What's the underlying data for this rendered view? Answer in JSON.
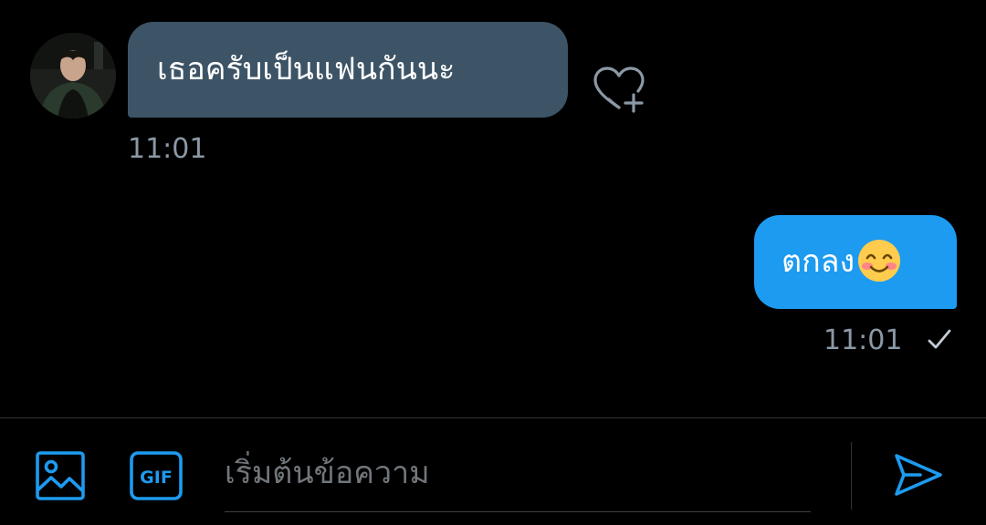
{
  "conversation": {
    "incoming": {
      "text": "เธอครับเป็นแฟนกันนะ",
      "time": "11:01",
      "avatar_icon": "contact-avatar",
      "reaction_icon": "heart-add-icon"
    },
    "outgoing": {
      "text": "ตกลง",
      "emoji": "smiling-face-with-blush",
      "time": "11:01",
      "status_icon": "check-icon"
    }
  },
  "composer": {
    "placeholder": "เริ่มต้นข้อความ",
    "gif_label": "GIF",
    "media_icon": "image-icon",
    "send_icon": "send-icon"
  },
  "colors": {
    "background": "#000000",
    "incoming_bubble": "#3d5466",
    "outgoing_bubble": "#1d9bf0",
    "accent": "#1d9bf0",
    "muted_text": "#8b98a5"
  }
}
